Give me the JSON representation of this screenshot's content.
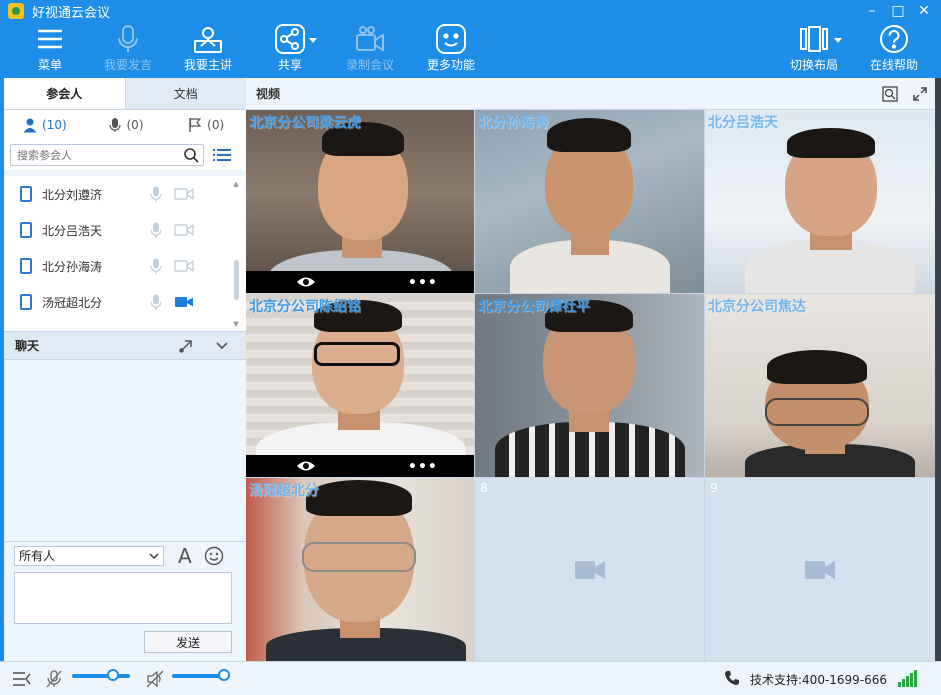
{
  "window": {
    "title": "好视通云会议",
    "controls": {
      "minimize": "–",
      "maximize": "□",
      "close": "✕"
    }
  },
  "toolbar": {
    "items": [
      {
        "id": "menu",
        "label": "菜单",
        "icon": "hamburger-icon",
        "enabled": true
      },
      {
        "id": "speak",
        "label": "我要发言",
        "icon": "microphone-icon",
        "enabled": false
      },
      {
        "id": "host",
        "label": "我要主讲",
        "icon": "presenter-icon",
        "enabled": true
      },
      {
        "id": "share",
        "label": "共享",
        "icon": "share-icon",
        "enabled": true
      },
      {
        "id": "record",
        "label": "录制会议",
        "icon": "record-camera-icon",
        "enabled": false
      },
      {
        "id": "more",
        "label": "更多功能",
        "icon": "smiley-icon",
        "enabled": true
      },
      {
        "id": "layout",
        "label": "切换布局",
        "icon": "layout-icon",
        "enabled": true
      },
      {
        "id": "help",
        "label": "在线帮助",
        "icon": "help-icon",
        "enabled": true
      }
    ]
  },
  "left_panel": {
    "tabs": [
      {
        "label": "参会人",
        "active": true
      },
      {
        "label": "文档",
        "active": false
      }
    ],
    "counts": {
      "participants": "(10)",
      "speakers": "(0)",
      "hands": "(0)"
    },
    "search": {
      "placeholder": "搜索参会人"
    },
    "participants": [
      {
        "name": "北分刘遵济",
        "video_on": false
      },
      {
        "name": "北分吕浩天",
        "video_on": false
      },
      {
        "name": "北分孙海涛",
        "video_on": false
      },
      {
        "name": "汤冠超北分",
        "video_on": true
      }
    ],
    "chat": {
      "title": "聊天",
      "target": "所有人",
      "font_button": "A",
      "send_label": "发送",
      "input_value": ""
    }
  },
  "video": {
    "title": "视频",
    "tiles": [
      {
        "name": "北京分公司梁云虎",
        "has_bar": true
      },
      {
        "name": "北分孙海涛",
        "has_bar": false
      },
      {
        "name": "北分吕浩天",
        "has_bar": false
      },
      {
        "name": "北京分公司陈绍铭",
        "has_bar": true
      },
      {
        "name": "北京分公司谭社平",
        "has_bar": false
      },
      {
        "name": "北京分公司焦达",
        "has_bar": false
      },
      {
        "name": "汤冠超北分",
        "has_bar": false
      },
      {
        "name": "8",
        "empty": true
      },
      {
        "name": "9",
        "empty": true
      }
    ],
    "bar_dots": "•••"
  },
  "statusbar": {
    "support_text": "技术支持:400-1699-666",
    "mic_volume": 0.75,
    "speaker_volume": 1.0
  },
  "colors": {
    "toolbar_bg": "#1e8de8",
    "panel_bg": "#eef4fb",
    "tile_name": "#3e9be8",
    "signal": "#29a742"
  }
}
